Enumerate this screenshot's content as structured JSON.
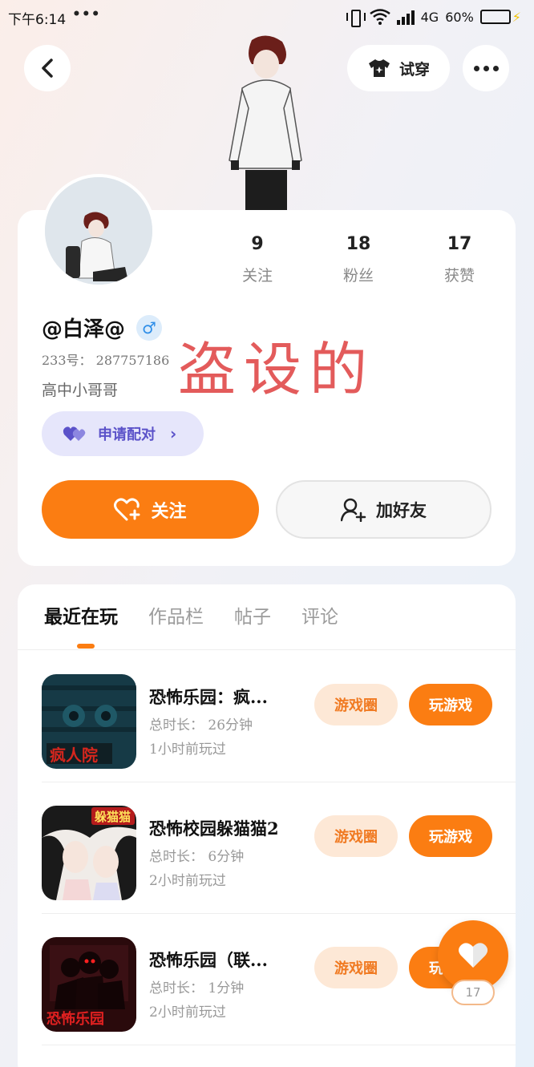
{
  "status_bar": {
    "time": "下午6:14",
    "dots": "•••",
    "network": "4G",
    "battery": "60%",
    "battery_level": 0.6
  },
  "header": {
    "back_icon": "chevron-left-icon",
    "tryon_label": "试穿",
    "more_icon": "more-icon"
  },
  "profile": {
    "stats": [
      {
        "value": "9",
        "label": "关注"
      },
      {
        "value": "18",
        "label": "粉丝"
      },
      {
        "value": "17",
        "label": "获赞"
      }
    ],
    "nickname": "@白泽@",
    "gender_symbol": "♂",
    "uid_label": "233号：",
    "uid_value": "287757186",
    "bio": "高中小哥哥",
    "watermark": "盗设的",
    "pair_label": "申请配对",
    "pair_chevron": "›",
    "follow_label": "关注",
    "add_friend_label": "加好友"
  },
  "tabs": [
    {
      "label": "最近在玩",
      "active": true
    },
    {
      "label": "作品栏",
      "active": false
    },
    {
      "label": "帖子",
      "active": false
    },
    {
      "label": "评论",
      "active": false
    }
  ],
  "games": [
    {
      "title": "恐怖乐园：疯...",
      "duration": "总时长： 26分钟",
      "last_played": "1小时前玩过",
      "circle_label": "游戏圈",
      "play_label": "玩游戏",
      "icon_text": "疯人院"
    },
    {
      "title": "恐怖校园躲猫猫2",
      "duration": "总时长： 6分钟",
      "last_played": "2小时前玩过",
      "circle_label": "游戏圈",
      "play_label": "玩游戏",
      "icon_text": "躲猫猫"
    },
    {
      "title": "恐怖乐园（联...",
      "duration": "总时长： 1分钟",
      "last_played": "2小时前玩过",
      "circle_label": "游戏圈",
      "play_label": "玩游戏",
      "icon_text": "恐怖乐园"
    }
  ],
  "fab": {
    "count": "17"
  },
  "colors": {
    "accent": "#fb7d12",
    "pair": "#5b52c9",
    "watermark": "#e04a4a"
  }
}
